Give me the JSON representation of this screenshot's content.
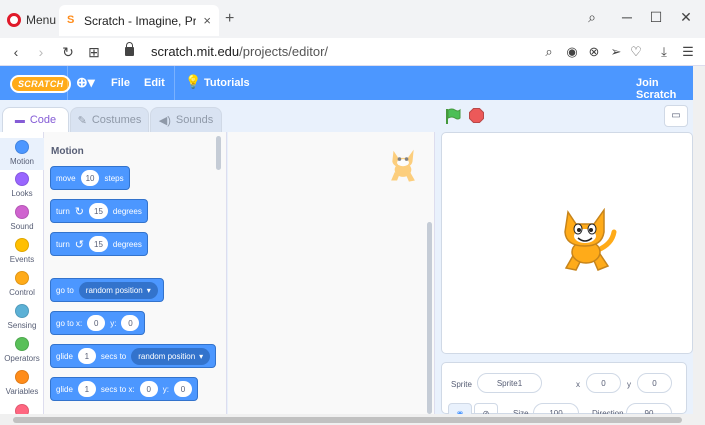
{
  "browser": {
    "menu_label": "Menu",
    "tab_title": "Scratch - Imagine, Program",
    "tab_close": "×",
    "new_tab": "+",
    "url_domain": "scratch.mit.edu",
    "url_path": "/projects/editor/"
  },
  "menubar": {
    "logo": "SCRATCH",
    "file": "File",
    "edit": "Edit",
    "tutorials": "Tutorials",
    "join": "Join Scratch"
  },
  "tabs": {
    "code": "Code",
    "costumes": "Costumes",
    "sounds": "Sounds"
  },
  "categories": [
    {
      "label": "Motion",
      "color": "#4c97ff"
    },
    {
      "label": "Looks",
      "color": "#9966ff"
    },
    {
      "label": "Sound",
      "color": "#cf63cf"
    },
    {
      "label": "Events",
      "color": "#ffbf00"
    },
    {
      "label": "Control",
      "color": "#ffab19"
    },
    {
      "label": "Sensing",
      "color": "#5cb1d6"
    },
    {
      "label": "Operators",
      "color": "#59c059"
    },
    {
      "label": "Variables",
      "color": "#ff8c1a"
    },
    {
      "label": "",
      "color": "#ff6680"
    }
  ],
  "palette": {
    "title": "Motion",
    "move": {
      "a": "move",
      "v": "10",
      "b": "steps"
    },
    "turn_right": {
      "a": "turn",
      "v": "15",
      "b": "degrees"
    },
    "turn_left": {
      "a": "turn",
      "v": "15",
      "b": "degrees"
    },
    "goto": {
      "a": "go to",
      "opt": "random position"
    },
    "goto_xy": {
      "a": "go to x:",
      "x": "0",
      "b": "y:",
      "y": "0"
    },
    "glide_to": {
      "a": "glide",
      "v": "1",
      "b": "secs to",
      "opt": "random position"
    },
    "glide_xy": {
      "a": "glide",
      "v": "1",
      "b": "secs to x:",
      "x": "0",
      "c": "y:",
      "y": "0"
    }
  },
  "sprite_info": {
    "sprite_label": "Sprite",
    "sprite_name": "Sprite1",
    "x_label": "x",
    "x_value": "0",
    "y_label": "y",
    "y_value": "0",
    "size_label": "Size",
    "size_value": "100",
    "direction_label": "Direction",
    "direction_value": "90"
  },
  "colors": {
    "scratch_blue": "#4c97ff",
    "green_flag": "#4cbf56",
    "stop": "#ec5959"
  }
}
